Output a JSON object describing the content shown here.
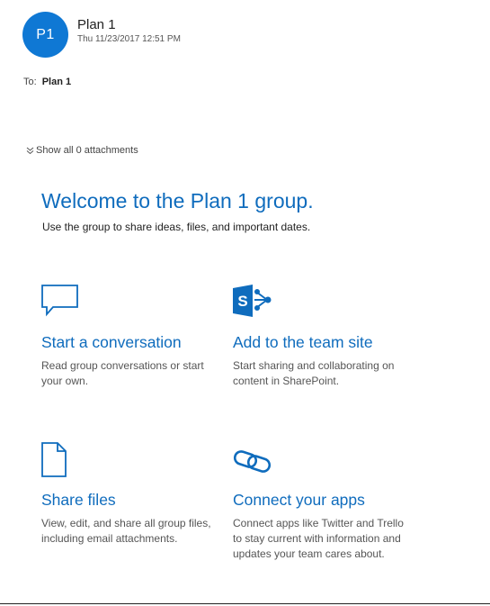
{
  "message": {
    "avatar_initials": "P1",
    "sender": "Plan 1",
    "timestamp": "Thu 11/23/2017 12:51 PM",
    "to_label": "To:",
    "to_name": "Plan 1",
    "attachments_label": "Show all 0 attachments"
  },
  "welcome": {
    "title": "Welcome to the Plan 1 group.",
    "subtitle": "Use the group to share ideas, files, and important dates."
  },
  "cards": [
    {
      "icon": "chat-bubble-icon",
      "title": "Start a conversation",
      "desc": "Read group conversations or start your own."
    },
    {
      "icon": "sharepoint-icon",
      "title": "Add to the team site",
      "desc": "Start sharing and collaborating on content in SharePoint."
    },
    {
      "icon": "file-icon",
      "title": "Share files",
      "desc": "View, edit, and share all group files, including email attachments."
    },
    {
      "icon": "link-icon",
      "title": "Connect your apps",
      "desc": "Connect apps like Twitter and Trello to stay current with information and updates your team cares about."
    }
  ],
  "colors": {
    "accent": "#0f6cbd",
    "avatar": "#0f78d4"
  }
}
